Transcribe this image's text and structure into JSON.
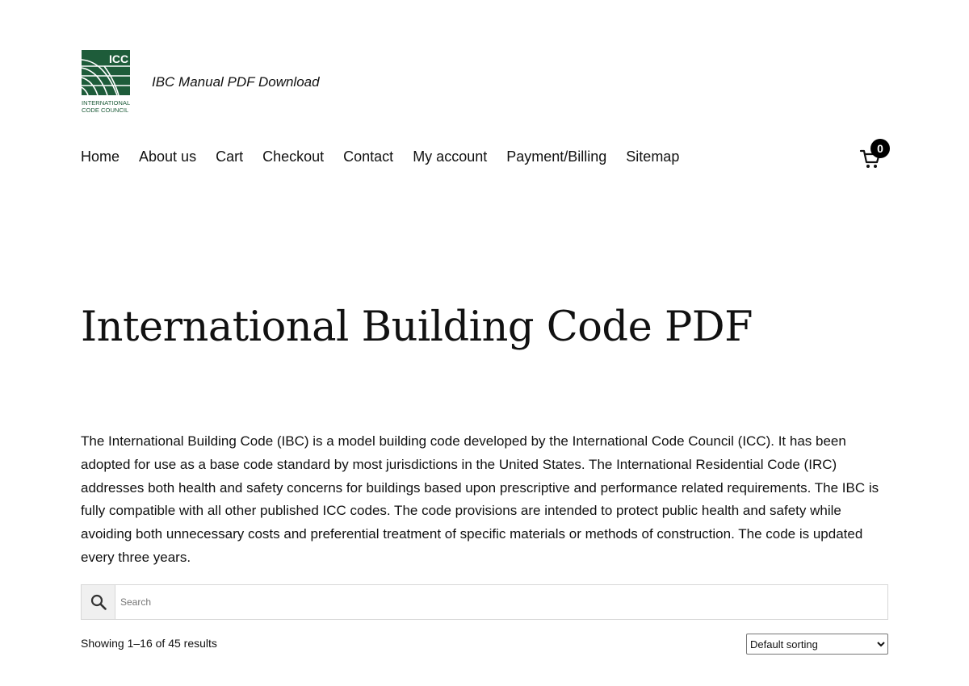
{
  "header": {
    "logo": {
      "line1": "ICC",
      "line2": "INTERNATIONAL",
      "line3": "CODE COUNCIL",
      "bg_color": "#1e5c3a"
    },
    "tagline": "IBC Manual PDF Download"
  },
  "nav": {
    "items": [
      {
        "label": "Home"
      },
      {
        "label": "About us"
      },
      {
        "label": "Cart"
      },
      {
        "label": "Checkout"
      },
      {
        "label": "Contact"
      },
      {
        "label": "My account"
      },
      {
        "label": "Payment/Billing"
      },
      {
        "label": "Sitemap"
      }
    ]
  },
  "cart": {
    "icon": "cart-icon",
    "count": "0"
  },
  "main": {
    "title": "International Building Code PDF",
    "intro": "The International Building Code (IBC) is a model building code developed by the International Code Council (ICC). It has been adopted for use as a base code standard by most jurisdictions in the United States. The International Residential Code (IRC) addresses both health and safety concerns for buildings based upon prescriptive and performance related requirements. The IBC is fully compatible with all other published ICC codes. The code provisions are intended to protect public health and safety while avoiding both unnecessary costs and preferential treatment of specific materials or methods of construction. The code is updated every three years."
  },
  "search": {
    "icon": "search-icon",
    "placeholder": "Search",
    "value": ""
  },
  "results": {
    "count_text": "Showing 1–16 of 45 results"
  },
  "sorting": {
    "selected": "Default sorting"
  }
}
